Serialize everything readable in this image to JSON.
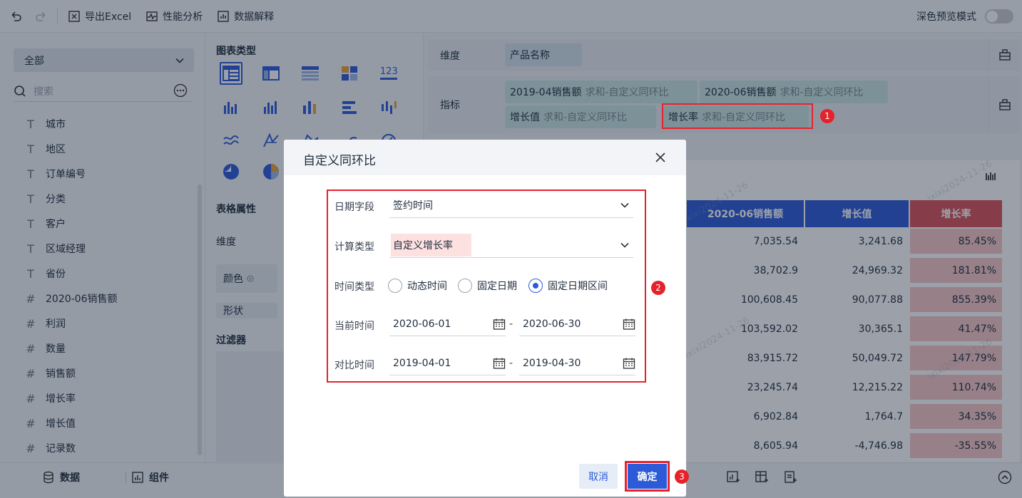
{
  "toolbar": {
    "export_excel": "导出Excel",
    "perf_analysis": "性能分析",
    "data_explain": "数据解释",
    "dark_preview": "深色预览模式"
  },
  "left": {
    "scope": "全部",
    "search_placeholder": "搜索",
    "fields": [
      {
        "type": "T",
        "label": "城市"
      },
      {
        "type": "T",
        "label": "地区"
      },
      {
        "type": "T",
        "label": "订单编号"
      },
      {
        "type": "T",
        "label": "分类"
      },
      {
        "type": "T",
        "label": "客户"
      },
      {
        "type": "T",
        "label": "区域经理"
      },
      {
        "type": "T",
        "label": "省份"
      },
      {
        "type": "#",
        "label": "2020-06销售额"
      },
      {
        "type": "#",
        "label": "利润"
      },
      {
        "type": "#",
        "label": "数量"
      },
      {
        "type": "#",
        "label": "销售额"
      },
      {
        "type": "#",
        "label": "增长率"
      },
      {
        "type": "#",
        "label": "增长值"
      },
      {
        "type": "#",
        "label": "记录数"
      }
    ]
  },
  "mid": {
    "chart_type_title": "图表类型",
    "table_props_title": "表格属性",
    "dimension": "维度",
    "color": "颜色",
    "shape": "形状",
    "filter_title": "过滤器"
  },
  "right": {
    "dim_label": "维度",
    "measure_label": "指标",
    "dim_pill": "产品名称",
    "measures": [
      {
        "name": "2019-04销售额",
        "sub": "求和-自定义同环比"
      },
      {
        "name": "2020-06销售额",
        "sub": "求和-自定义同环比"
      },
      {
        "name": "增长值",
        "sub": "求和-自定义同环比"
      },
      {
        "name": "增长率",
        "sub": "求和-自定义同环比"
      }
    ],
    "table_headers": [
      "2020-06销售额",
      "增长值",
      "增长率"
    ],
    "rows": [
      [
        "7,035.54",
        "3,241.68",
        "85.45%"
      ],
      [
        "38,702.9",
        "24,969.32",
        "181.81%"
      ],
      [
        "100,608.45",
        "90,077.88",
        "855.39%"
      ],
      [
        "103,592.02",
        "30,365.1",
        "41.47%"
      ],
      [
        "83,915.72",
        "50,049.72",
        "147.79%"
      ],
      [
        "23,245.74",
        "12,215.22",
        "110.74%"
      ],
      [
        "6,902.84",
        "1,764.7",
        "34.35%"
      ],
      [
        "8,605.94",
        "-4,746.98",
        "-35.55%"
      ]
    ],
    "watermark": "ixixi2024-11-26"
  },
  "bottom": {
    "data_tab": "数据",
    "component_tab": "组件"
  },
  "dialog": {
    "title": "自定义同环比",
    "date_field_label": "日期字段",
    "date_field_value": "签约时间",
    "calc_type_label": "计算类型",
    "calc_type_value": "自定义增长率",
    "time_type_label": "时间类型",
    "time_options": [
      "动态时间",
      "固定日期",
      "固定日期区间"
    ],
    "selected_time_option": "固定日期区间",
    "current_label": "当前时间",
    "current_start": "2020-06-01",
    "current_end": "2020-06-30",
    "compare_label": "对比时间",
    "compare_start": "2019-04-01",
    "compare_end": "2019-04-30",
    "range_dash": "-",
    "cancel": "取消",
    "confirm": "确定"
  },
  "annotations": [
    "1",
    "2",
    "3"
  ],
  "colors": {
    "accent": "#2d5bd7",
    "highlight_red": "#e5222c",
    "rate_bg": "#f6c6c6"
  }
}
